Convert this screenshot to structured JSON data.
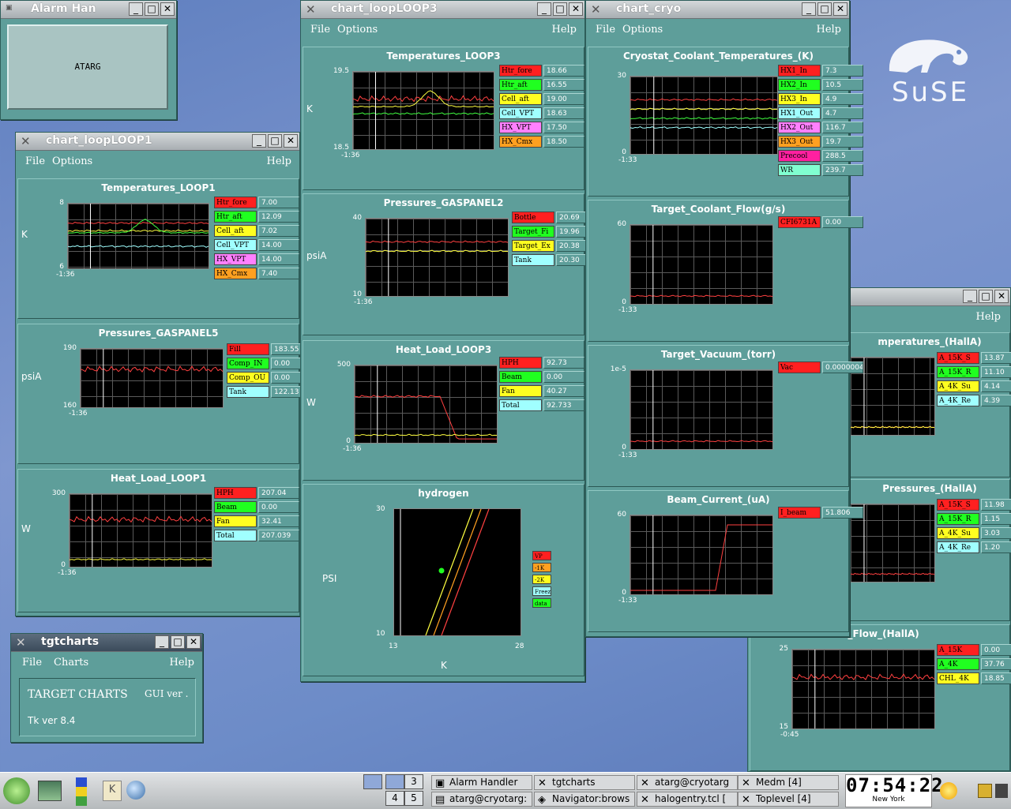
{
  "desktop": {
    "logo_text": "SuSE"
  },
  "alarm_window": {
    "title": "Alarm Han",
    "button_label": "ATARG"
  },
  "tgtcharts": {
    "title": "tgtcharts",
    "menu": {
      "file": "File",
      "charts": "Charts",
      "help": "Help"
    },
    "heading": "TARGET CHARTS",
    "gui_ver": "GUI ver .",
    "tk_ver": "Tk ver 8.4"
  },
  "loop1": {
    "title": "chart_loopLOOP1",
    "menu": {
      "file": "File",
      "options": "Options",
      "help": "Help"
    },
    "panels": [
      {
        "title": "Temperatures_LOOP1",
        "ylabel": "K",
        "ymax": "8",
        "ymin": "6",
        "xmin": "-1:36",
        "legend": [
          {
            "name": "Htr_fore",
            "color": "#ff2020",
            "value": "7.00"
          },
          {
            "name": "Htr_aft",
            "color": "#20ff20",
            "value": "12.09"
          },
          {
            "name": "Cell_aft",
            "color": "#ffff20",
            "value": "7.02"
          },
          {
            "name": "Cell_VPT",
            "color": "#a0ffff",
            "value": "14.00"
          },
          {
            "name": "HX_VPT",
            "color": "#ff80ff",
            "value": "14.00"
          },
          {
            "name": "HX_Cmx",
            "color": "#ffa020",
            "value": "7.40"
          }
        ]
      },
      {
        "title": "Pressures_GASPANEL5",
        "ylabel": "psiA",
        "ymax": "190",
        "ymin": "160",
        "xmin": "-1:36",
        "legend": [
          {
            "name": "Fill",
            "color": "#ff2020",
            "value": "183.55"
          },
          {
            "name": "Comp_IN",
            "color": "#20ff20",
            "value": "0.00"
          },
          {
            "name": "Comp_OU",
            "color": "#ffff20",
            "value": "0.00"
          },
          {
            "name": "Tank",
            "color": "#a0ffff",
            "value": "122.13"
          }
        ]
      },
      {
        "title": "Heat_Load_LOOP1",
        "ylabel": "W",
        "ymax": "300",
        "ymin": "0",
        "xmin": "-1:36",
        "legend": [
          {
            "name": "HPH",
            "color": "#ff2020",
            "value": "207.04"
          },
          {
            "name": "Beam",
            "color": "#20ff20",
            "value": "0.00"
          },
          {
            "name": "Fan",
            "color": "#ffff20",
            "value": "32.41"
          },
          {
            "name": "Total",
            "color": "#a0ffff",
            "value": "207.039"
          }
        ]
      }
    ]
  },
  "loop3": {
    "title": "chart_loopLOOP3",
    "menu": {
      "file": "File",
      "options": "Options",
      "help": "Help"
    },
    "panels": [
      {
        "title": "Temperatures_LOOP3",
        "ylabel": "K",
        "ymax": "19.5",
        "ymin": "18.5",
        "xmin": "-1:36",
        "legend": [
          {
            "name": "Htr_fore",
            "color": "#ff2020",
            "value": "18.66"
          },
          {
            "name": "Htr_aft",
            "color": "#20ff20",
            "value": "16.55"
          },
          {
            "name": "Cell_aft",
            "color": "#ffff20",
            "value": "19.00"
          },
          {
            "name": "Cell_VPT",
            "color": "#a0ffff",
            "value": "18.63"
          },
          {
            "name": "HX_VPT",
            "color": "#ff80ff",
            "value": "17.50"
          },
          {
            "name": "HX_Cmx",
            "color": "#ffa020",
            "value": "18.50"
          }
        ]
      },
      {
        "title": "Pressures_GASPANEL2",
        "ylabel": "psiA",
        "ymax": "40",
        "ymin": "10",
        "xmin": "-1:36",
        "legend": [
          {
            "name": "Bottle",
            "color": "#ff2020",
            "value": "20.69"
          },
          {
            "name": "Target_Fi",
            "color": "#20ff20",
            "value": "19.96"
          },
          {
            "name": "Target_Ex",
            "color": "#ffff20",
            "value": "20.38"
          },
          {
            "name": "Tank",
            "color": "#a0ffff",
            "value": "20.30"
          }
        ]
      },
      {
        "title": "Heat_Load_LOOP3",
        "ylabel": "W",
        "ymax": "500",
        "ymin": "0",
        "xmin": "-1:36",
        "legend": [
          {
            "name": "HPH",
            "color": "#ff2020",
            "value": "92.73"
          },
          {
            "name": "Beam",
            "color": "#20ff20",
            "value": "0.00"
          },
          {
            "name": "Fan",
            "color": "#ffff20",
            "value": "40.27"
          },
          {
            "name": "Total",
            "color": "#a0ffff",
            "value": "92.733"
          }
        ]
      }
    ],
    "hydrogen": {
      "title": "hydrogen",
      "ylabel": "PSI",
      "xlabel": "K",
      "ymax": "30",
      "ymin": "10",
      "xmin": "13",
      "xmax": "28",
      "legend": [
        {
          "name": "VP",
          "color": "#ff2020"
        },
        {
          "name": "-1K",
          "color": "#ffa020"
        },
        {
          "name": "-2K",
          "color": "#ffff20"
        },
        {
          "name": "Freeze",
          "color": "#a0ffff"
        },
        {
          "name": "data",
          "color": "#20ff20"
        }
      ]
    }
  },
  "cryo": {
    "title": "chart_cryo",
    "menu": {
      "file": "File",
      "options": "Options",
      "help": "Help"
    },
    "panels": [
      {
        "title": "Cryostat_Coolant_Temperatures_(K)",
        "ymax": "30",
        "ymin": "0",
        "xmin": "-1:33",
        "legend": [
          {
            "name": "HX1_In",
            "color": "#ff2020",
            "value": "7.3"
          },
          {
            "name": "HX2_In",
            "color": "#20ff20",
            "value": "10.5"
          },
          {
            "name": "HX3_In",
            "color": "#ffff20",
            "value": "4.9"
          },
          {
            "name": "HX1_Out",
            "color": "#a0ffff",
            "value": "4.7"
          },
          {
            "name": "HX2_Out",
            "color": "#ff80ff",
            "value": "116.7"
          },
          {
            "name": "HX3_Out",
            "color": "#ffa020",
            "value": "19.7"
          },
          {
            "name": "Precool",
            "color": "#ff20a0",
            "value": "288.5"
          },
          {
            "name": "WR",
            "color": "#80ffd0",
            "value": "239.7"
          }
        ]
      },
      {
        "title": "Target_Coolant_Flow(g/s)",
        "ymax": "60",
        "ymin": "0",
        "xmin": "-1:33",
        "legend": [
          {
            "name": "CFI6731A",
            "color": "#ff2020",
            "value": "0.00"
          }
        ]
      },
      {
        "title": "Target_Vacuum_(torr)",
        "ymax": "1e-5",
        "ymin": "0",
        "xmin": "-1:33",
        "legend": [
          {
            "name": "Vac",
            "color": "#ff2020",
            "value": "0.0000004"
          }
        ]
      },
      {
        "title": "Beam_Current_(uA)",
        "ymax": "60",
        "ymin": "0",
        "xmin": "-1:33",
        "legend": [
          {
            "name": "I_beam",
            "color": "#ff2020",
            "value": "51.806"
          }
        ]
      }
    ]
  },
  "halla": {
    "menu": {
      "help": "Help"
    },
    "panels": [
      {
        "title": "mperatures_(HallA)",
        "legend": [
          {
            "name": "A_15K_S",
            "color": "#ff2020",
            "value": "13.87"
          },
          {
            "name": "A_15K_R",
            "color": "#20ff20",
            "value": "11.10"
          },
          {
            "name": "A_4K_Su",
            "color": "#ffff20",
            "value": "4.14"
          },
          {
            "name": "A_4K_Re",
            "color": "#a0ffff",
            "value": "4.39"
          }
        ]
      },
      {
        "title": "Pressures_(HallA)",
        "legend": [
          {
            "name": "A_15K_S",
            "color": "#ff2020",
            "value": "11.98"
          },
          {
            "name": "A_15K_R",
            "color": "#20ff20",
            "value": "1.15"
          },
          {
            "name": "A_4K_Su",
            "color": "#ffff20",
            "value": "3.03"
          },
          {
            "name": "A_4K_Re",
            "color": "#a0ffff",
            "value": "1.20"
          }
        ]
      },
      {
        "title": "R_Flow_(HallA)",
        "ymax": "25",
        "ymin": "15",
        "xmin": "-0:45",
        "legend": [
          {
            "name": "A_15K",
            "color": "#ff2020",
            "value": "0.00"
          },
          {
            "name": "A_4K",
            "color": "#20ff20",
            "value": "37.76"
          },
          {
            "name": "CHL_4K",
            "color": "#ffff20",
            "value": "18.85"
          }
        ]
      }
    ]
  },
  "taskbar": {
    "pager": [
      "3",
      "4",
      "5"
    ],
    "tasks": [
      {
        "label": "Alarm Handler",
        "icon": "alarm-icon"
      },
      {
        "label": "tgtcharts",
        "icon": "x-icon"
      },
      {
        "label": "atarg@cryotarg",
        "icon": "x-icon"
      },
      {
        "label": "Medm [4]",
        "icon": "x-icon"
      },
      {
        "label": "atarg@cryotarg:",
        "icon": "terminal-icon"
      },
      {
        "label": "Navigator:brows",
        "icon": "navigator-icon"
      },
      {
        "label": "halogentry.tcl [",
        "icon": "x-icon"
      },
      {
        "label": "Toplevel [4]",
        "icon": "x-icon"
      }
    ],
    "clock": "07:54:22",
    "city": "New York"
  }
}
